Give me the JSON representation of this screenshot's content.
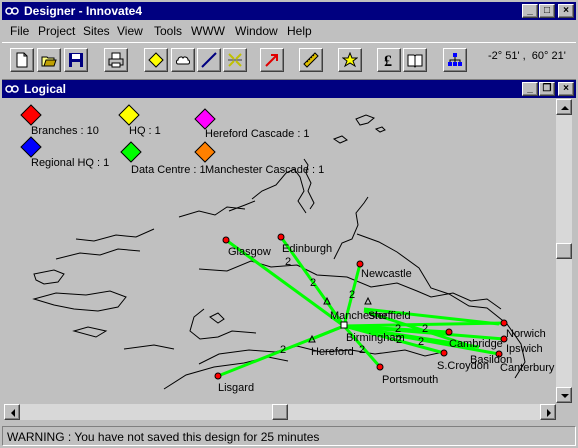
{
  "window": {
    "title": "Designer - Innovate4",
    "minimize": "_",
    "maximize": "□",
    "close": "×"
  },
  "menu": [
    "File",
    "Project",
    "Sites",
    "View",
    "Tools",
    "WWW",
    "Window",
    "Help"
  ],
  "toolbar": {
    "buttons": [
      "new-icon",
      "open-icon",
      "save-icon",
      "print-icon",
      "branch-diamond-icon",
      "cloud-icon",
      "line-icon",
      "split-icon",
      "red-arrow-icon",
      "ruler-icon",
      "star-icon",
      "pound-icon",
      "book-icon",
      "network-icon"
    ],
    "coordinates": "-2° 51' ,  60° 21'"
  },
  "child_window": {
    "title": "Logical",
    "minimize": "_",
    "restore": "❐",
    "close": "×"
  },
  "legend": [
    {
      "label": "Branches : 10",
      "color": "#ff0000"
    },
    {
      "label": "HQ : 1",
      "color": "#ffff00"
    },
    {
      "label": "Hereford Cascade : 1",
      "color": "#ff00ff"
    },
    {
      "label": "Regional HQ : 1",
      "color": "#0000ff"
    },
    {
      "label": "Data Centre : 1",
      "color": "#00ff00"
    },
    {
      "label": "Manchester Cascade : 1",
      "color": "#ff8000"
    }
  ],
  "sites": [
    "Glasgow",
    "Edinburgh",
    "Newcastle",
    "Manchester",
    "Sheffield",
    "Birmingham",
    "Hereford",
    "Norwich",
    "Cambridge",
    "Ipswich",
    "Basildon",
    "Canterbury",
    "S.Croydon",
    "Portsmouth",
    "Lisgard"
  ],
  "link_counts": [
    "2",
    "2",
    "2",
    "2",
    "2",
    "2",
    "2",
    "2",
    "2"
  ],
  "colors": {
    "link": "#00ff00",
    "site_node": "#ff0000",
    "title_bar": "#000080"
  },
  "status": "WARNING : You have not saved this design for 25 minutes"
}
